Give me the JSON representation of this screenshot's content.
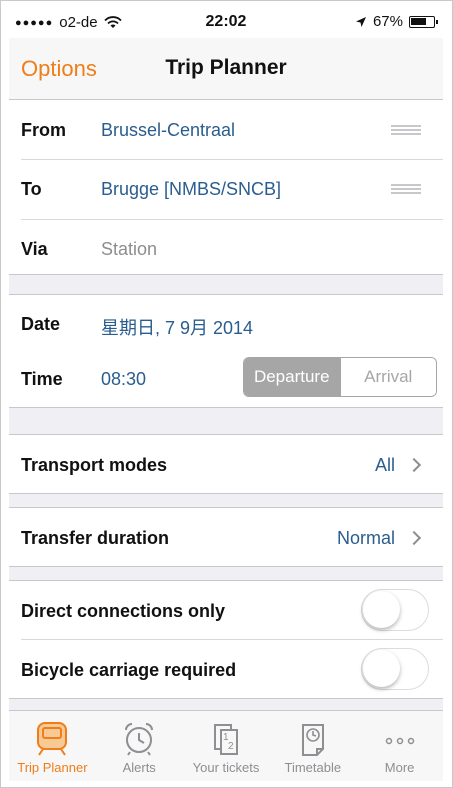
{
  "status": {
    "signal_dots": "●●●●●",
    "carrier": "o2-de",
    "time": "22:02",
    "battery": "67%"
  },
  "navbar": {
    "back_label": "Options",
    "title": "Trip Planner"
  },
  "route": {
    "from_label": "From",
    "from_value": "Brussel-Centraal",
    "to_label": "To",
    "to_value": "Brugge [NMBS/SNCB]",
    "via_label": "Via",
    "via_placeholder": "Station"
  },
  "datetime": {
    "date_label": "Date",
    "date_value": "星期日, 7 9月 2014",
    "time_label": "Time",
    "time_value": "08:30",
    "mode_departure": "Departure",
    "mode_arrival": "Arrival",
    "selected_mode": "Departure"
  },
  "transport": {
    "label": "Transport modes",
    "value": "All"
  },
  "transfer": {
    "label": "Transfer duration",
    "value": "Normal"
  },
  "options": {
    "direct_label": "Direct connections only",
    "direct_on": false,
    "bicycle_label": "Bicycle carriage required",
    "bicycle_on": false
  },
  "tabs": [
    {
      "label": "Trip Planner",
      "icon": "train-icon",
      "active": true
    },
    {
      "label": "Alerts",
      "icon": "alarm-clock-icon",
      "active": false
    },
    {
      "label": "Your tickets",
      "icon": "tickets-icon",
      "active": false
    },
    {
      "label": "Timetable",
      "icon": "timetable-icon",
      "active": false
    },
    {
      "label": "More",
      "icon": "more-icon",
      "active": false
    }
  ],
  "colors": {
    "accent": "#ef7d1a",
    "value_blue": "#2a5d8f",
    "group_background": "#efeff4"
  }
}
